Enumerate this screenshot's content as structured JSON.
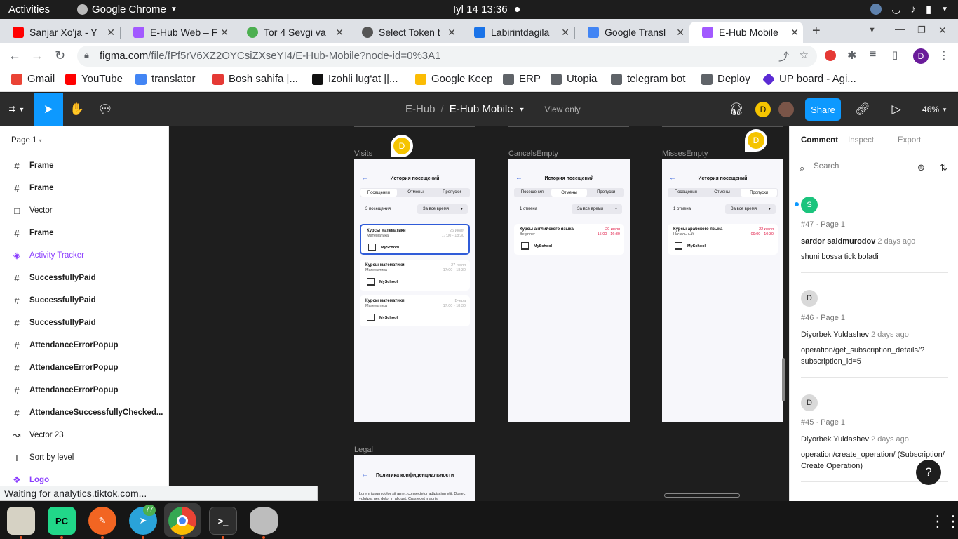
{
  "topbar": {
    "activities": "Activities",
    "app": "Google Chrome",
    "clock": "Iyl 14  13:36"
  },
  "tabs": [
    {
      "label": "Sanjar Xo'ja - Y",
      "color": "#ff0000"
    },
    {
      "label": "E-Hub Web – F",
      "color": "#a259ff"
    },
    {
      "label": "Tor 4 Sevgi va",
      "color": "#4caf50"
    },
    {
      "label": "Select Token t",
      "color": "#555555"
    },
    {
      "label": "Labirintdagila",
      "color": "#1a73e8"
    },
    {
      "label": "Google Transl",
      "color": "#4285f4"
    },
    {
      "label": "E-Hub Mobile",
      "color": "#a259ff"
    }
  ],
  "address": {
    "host": "figma.com",
    "path": "/file/fPf5rV6XZ2OYCsiZXseYI4/E-Hub-Mobile?node-id=0%3A1"
  },
  "bookmarks": [
    "Gmail",
    "YouTube",
    "translator",
    "Bosh sahifa |...",
    "Izohli lug‘at ||...",
    "Google Keep",
    "ERP",
    "Utopia",
    "telegram bot",
    "Deploy",
    "UP board - Agi..."
  ],
  "figma": {
    "project": "E-Hub",
    "file": "E-Hub Mobile",
    "view_only": "View only",
    "share": "Share",
    "zoom": "46%",
    "avatar": "D"
  },
  "layers": {
    "page": "Page 1",
    "items": [
      {
        "name": "Frame",
        "icon": "#",
        "bold": true
      },
      {
        "name": "Frame",
        "icon": "#",
        "bold": true
      },
      {
        "name": "Vector",
        "icon": "□",
        "bold": false
      },
      {
        "name": "Frame",
        "icon": "#",
        "bold": true
      },
      {
        "name": "Activity Tracker",
        "icon": "◈",
        "bold": false,
        "purple": true
      },
      {
        "name": "SuccessfullyPaid",
        "icon": "#",
        "bold": true
      },
      {
        "name": "SuccessfullyPaid",
        "icon": "#",
        "bold": true
      },
      {
        "name": "SuccessfullyPaid",
        "icon": "#",
        "bold": true
      },
      {
        "name": "AttendanceErrorPopup",
        "icon": "#",
        "bold": true
      },
      {
        "name": "AttendanceErrorPopup",
        "icon": "#",
        "bold": true
      },
      {
        "name": "AttendanceErrorPopup",
        "icon": "#",
        "bold": true
      },
      {
        "name": "AttendanceSuccessfullyChecked...",
        "icon": "#",
        "bold": true
      },
      {
        "name": "Vector 23",
        "icon": "↝",
        "bold": false
      },
      {
        "name": "Sort by level",
        "icon": "T",
        "bold": false
      },
      {
        "name": "Logo",
        "icon": "❖",
        "bold": true,
        "purple": true
      }
    ]
  },
  "frames": {
    "visits": {
      "label": "Visits",
      "title": "История посещений",
      "tabs": [
        "Посещения",
        "Отмены",
        "Пропуски"
      ],
      "count": "3 посещения",
      "filter": "За все время",
      "cards": [
        {
          "title": "Курсы математики",
          "sub": "Математика",
          "date": "25 июля",
          "time": "17:00 - 18:30",
          "school": "MySchool"
        },
        {
          "title": "Курсы математики",
          "sub": "Математика",
          "date": "27 июля",
          "time": "17:00 - 18:30",
          "school": "MySchool"
        },
        {
          "title": "Курсы математики",
          "sub": "Математика",
          "date": "Вчера",
          "time": "17:00 - 18:30",
          "school": "MySchool"
        }
      ]
    },
    "cancels": {
      "label": "CancelsEmpty",
      "title": "История посещений",
      "tabs": [
        "Посещения",
        "Отмены",
        "Пропуски"
      ],
      "count": "1 отмена",
      "filter": "За все время",
      "cards": [
        {
          "title": "Курсы английского языка",
          "sub": "Beginner",
          "date": "20 июля",
          "time": "15:00 - 16:30",
          "school": "MySchool"
        }
      ]
    },
    "misses": {
      "label": "MissesEmpty",
      "title": "История посещений",
      "tabs": [
        "Посещения",
        "Отмены",
        "Пропуски"
      ],
      "count": "1 отмена",
      "filter": "За все время",
      "cards": [
        {
          "title": "Курсы арабского языка",
          "sub": "Начальный",
          "date": "22 июля",
          "time": "09:00 - 10:30",
          "school": "MySchool"
        }
      ]
    },
    "legal": {
      "label": "Legal",
      "title": "Политика конфиденциальности",
      "text": "Lorem ipsum dolor sit amet, consectetur adipiscing elit. Donec volutpat nec dolor in aliquet. Cras eget mauris"
    }
  },
  "comments_panel": {
    "tabs": [
      "Comment",
      "Inspect",
      "Export"
    ],
    "search_placeholder": "Search",
    "comments": [
      {
        "initial": "S",
        "color": "#1bc47d",
        "meta": "#47 · Page 1",
        "author": "sardor saidmurodov",
        "ago": "2 days ago",
        "body": "shuni bossa tick boladi"
      },
      {
        "initial": "D",
        "color": "#cfcfcf",
        "meta": "#46 · Page 1",
        "author": "Diyorbek Yuldashev",
        "ago": "2 days ago",
        "body": "operation/get_subscription_details/?subscription_id=5"
      },
      {
        "initial": "D",
        "color": "#cfcfcf",
        "meta": "#45 · Page 1",
        "author": "Diyorbek Yuldashev",
        "ago": "2 days ago",
        "body": "operation/create_operation/ (Subscription/ Create Operation)"
      }
    ]
  },
  "status": "Waiting for analytics.tiktok.com...",
  "dock": {
    "telegram_badge": "77"
  }
}
